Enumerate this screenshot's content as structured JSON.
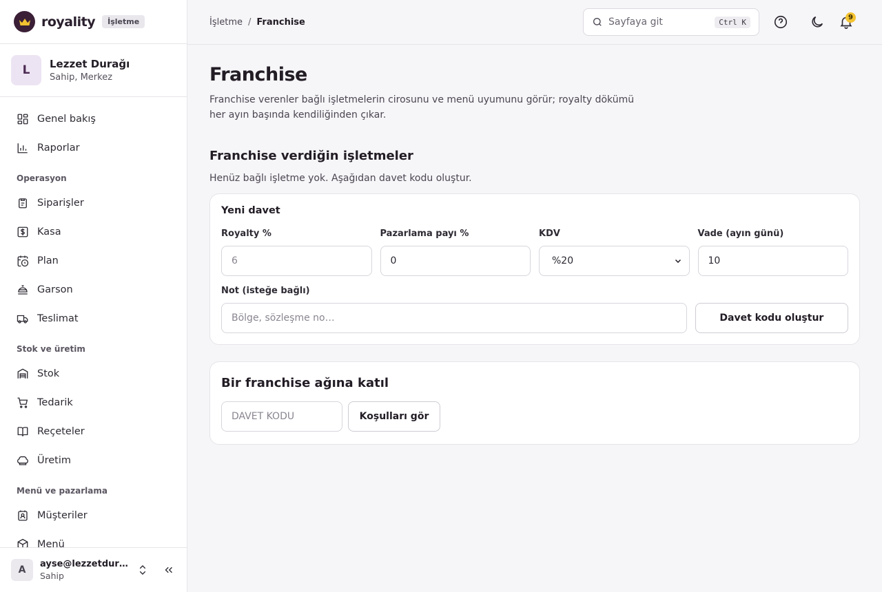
{
  "brand": {
    "name": "royality",
    "badge": "İşletme"
  },
  "business": {
    "initial": "L",
    "name": "Lezzet Durağı",
    "role": "Sahip, Merkez"
  },
  "nav": {
    "top": [
      {
        "label": "Genel bakış",
        "icon": "grid-icon"
      },
      {
        "label": "Raporlar",
        "icon": "bar-chart-icon"
      }
    ],
    "sections": [
      {
        "title": "Operasyon",
        "items": [
          {
            "label": "Siparişler",
            "icon": "clipboard-icon"
          },
          {
            "label": "Kasa",
            "icon": "dollar-icon"
          },
          {
            "label": "Plan",
            "icon": "calendar-clock-icon"
          },
          {
            "label": "Garson",
            "icon": "cloche-icon"
          },
          {
            "label": "Teslimat",
            "icon": "truck-icon"
          }
        ]
      },
      {
        "title": "Stok ve üretim",
        "items": [
          {
            "label": "Stok",
            "icon": "warehouse-icon"
          },
          {
            "label": "Tedarik",
            "icon": "cart-icon"
          },
          {
            "label": "Reçeteler",
            "icon": "book-icon"
          },
          {
            "label": "Üretim",
            "icon": "chef-hat-icon"
          }
        ]
      },
      {
        "title": "Menü ve pazarlama",
        "items": [
          {
            "label": "Müşteriler",
            "icon": "contact-icon"
          },
          {
            "label": "Menü",
            "icon": "package-icon"
          }
        ]
      }
    ]
  },
  "user": {
    "initial": "A",
    "email": "ayse@lezzetduragi.com",
    "role": "Sahip"
  },
  "breadcrumb": {
    "parent": "İşletme",
    "separator": "/",
    "current": "Franchise"
  },
  "search": {
    "placeholder": "Sayfaya git",
    "shortcut": "Ctrl K"
  },
  "notifications": {
    "count": "9"
  },
  "page": {
    "title": "Franchise",
    "description": "Franchise verenler bağlı işletmelerin cirosunu ve menü uyumunu görür; royalty dökümü her ayın başında kendiliğinden çıkar."
  },
  "franchisees": {
    "title": "Franchise verdiğin işletmeler",
    "empty_note": "Henüz bağlı işletme yok. Aşağıdan davet kodu oluştur."
  },
  "invite": {
    "title": "Yeni davet",
    "royalty_label": "Royalty %",
    "royalty_placeholder": "6",
    "marketing_label": "Pazarlama payı %",
    "marketing_value": "0",
    "kdv_label": "KDV",
    "kdv_value": "%20",
    "due_label": "Vade (ayın günü)",
    "due_value": "10",
    "note_label": "Not (isteğe bağlı)",
    "note_placeholder": "Bölge, sözleşme no…",
    "submit_label": "Davet kodu oluştur"
  },
  "join": {
    "title": "Bir franchise ağına katıl",
    "code_placeholder": "DAVET KODU",
    "button_label": "Koşulları gör"
  },
  "colors": {
    "brand_dark": "#3a1f36",
    "crown": "#f2c230",
    "notif_badge": "#f2c230"
  }
}
